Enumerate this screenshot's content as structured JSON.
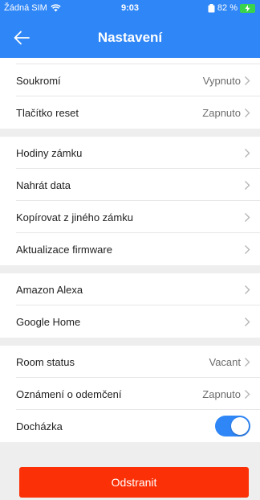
{
  "status_bar": {
    "carrier": "Žádná SIM",
    "time": "9:03",
    "battery": "82 %"
  },
  "nav": {
    "title": "Nastavení",
    "back_icon": "back-arrow-icon"
  },
  "settings": {
    "group1": [
      {
        "label": "Soukromí",
        "value": "Vypnuto"
      },
      {
        "label": "Tlačítko reset",
        "value": "Zapnuto"
      }
    ],
    "group2": [
      {
        "label": "Hodiny zámku"
      },
      {
        "label": "Nahrát data"
      },
      {
        "label": "Kopírovat z jiného zámku"
      },
      {
        "label": "Aktualizace firmware"
      }
    ],
    "group3": [
      {
        "label": "Amazon Alexa"
      },
      {
        "label": "Google Home"
      }
    ],
    "group4": [
      {
        "label": "Room status",
        "value": "Vacant"
      },
      {
        "label": "Oznámení o odemčení",
        "value": "Zapnuto"
      },
      {
        "label": "Docházka",
        "toggle": true
      }
    ]
  },
  "actions": {
    "delete_label": "Odstranit"
  },
  "colors": {
    "accent": "#2f86f6",
    "danger": "#fb3006",
    "background": "#eeeeee"
  }
}
